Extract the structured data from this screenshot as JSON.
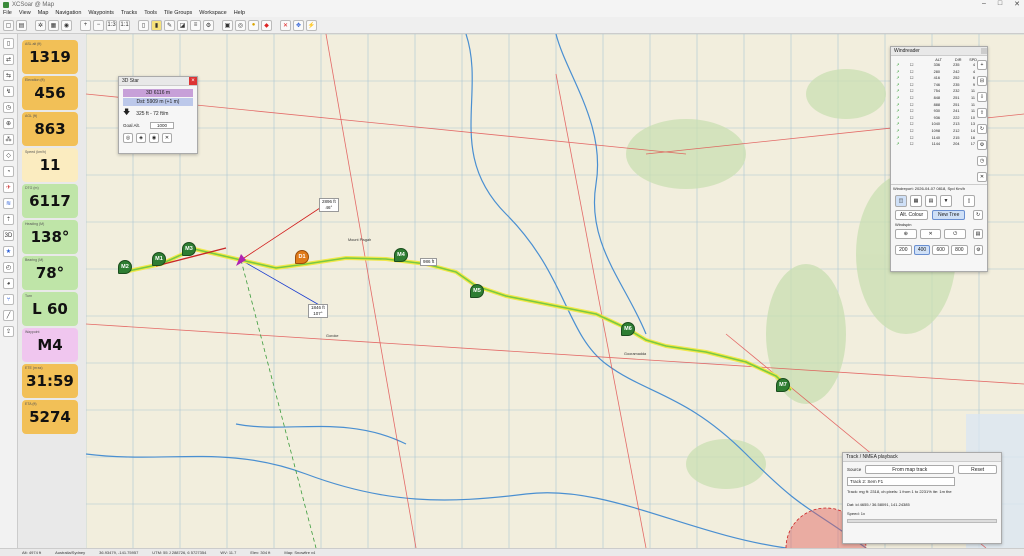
{
  "window": {
    "title": "XCSoar @ Map"
  },
  "menu": [
    "File",
    "View",
    "Map",
    "Navigation",
    "Waypoints",
    "Tracks",
    "Tools",
    "Tile Groups",
    "Workspace",
    "Help"
  ],
  "toolbar": {
    "icons": [
      "new-icon",
      "open-icon",
      "settings-icon",
      "map-icon",
      "eye-icon",
      "zoom-in-icon",
      "zoom-out-icon",
      "scale-icon",
      "scale-icon",
      "doc-icon",
      "book-icon",
      "edit-icon",
      "ruler-icon",
      "list-icon",
      "gear-icon",
      "lock-icon",
      "target-icon",
      "pin-icon",
      "flag-icon",
      "close-icon",
      "move-icon",
      "power-icon"
    ],
    "zoom_labels": [
      "1:3",
      "1:1"
    ]
  },
  "gauges": [
    {
      "label": "ASL alt (ft)",
      "value": "1319",
      "color": "#f2c057"
    },
    {
      "label": "Elevation (ft)",
      "value": "456",
      "color": "#f2c057"
    },
    {
      "label": "AGL (ft)",
      "value": "863",
      "color": "#f2c057"
    },
    {
      "label": "Speed (km/h)",
      "value": "11",
      "color": "#fbecc0"
    },
    {
      "label": "DTG (m)",
      "value": "6117",
      "color": "#bfe5a8"
    },
    {
      "label": "Heading (M)",
      "value": "138°",
      "color": "#bfe5a8"
    },
    {
      "label": "Bearing (M)",
      "value": "78°",
      "color": "#bfe5a8"
    },
    {
      "label": "Turn",
      "value": "L 60",
      "color": "#bfe5a8"
    },
    {
      "label": "Waypoint",
      "value": "M4",
      "color": "#f0c6ef"
    },
    {
      "label": "ETE (m:ss)",
      "value": "31:59",
      "color": "#f2c057"
    },
    {
      "label": "ETA (ft)",
      "value": "5274",
      "color": "#f2c057"
    }
  ],
  "star_panel": {
    "title": "3D Star",
    "row1": "3D 6116 m",
    "row2": "Dst: 5909 m (+1 m)",
    "row3": "325 ft - 72 ft/m",
    "goal_label": "Goal Alt.",
    "goal_value": "1000"
  },
  "map_labels": {
    "dist1": "2896 ft",
    "dist1b": "46°",
    "dist2": "1846 ft",
    "dist2b": "107°",
    "dist3": "986 ft"
  },
  "markers": [
    "M1",
    "M2",
    "M3",
    "D1",
    "M4",
    "M5",
    "M6",
    "M7"
  ],
  "place_labels": [
    "Mount Pisgah",
    "Goroke",
    "Gooramadda"
  ],
  "wind_panel": {
    "title": "Windreader",
    "headers": [
      "",
      "",
      "ALT",
      "DIR",
      "SPD"
    ],
    "rows": [
      [
        "↗",
        "☐",
        "336",
        "235",
        "4"
      ],
      [
        "↗",
        "☐",
        "280",
        "242",
        "4"
      ],
      [
        "↗",
        "☐",
        "416",
        "252",
        "6"
      ],
      [
        "↗",
        "☐",
        "746",
        "235",
        "9"
      ],
      [
        "↗",
        "☐",
        "754",
        "232",
        "11"
      ],
      [
        "↗",
        "☐",
        "848",
        "251",
        "11"
      ],
      [
        "↗",
        "☐",
        "888",
        "251",
        "11"
      ],
      [
        "↗",
        "☐",
        "930",
        "241",
        "11"
      ],
      [
        "↗",
        "☐",
        "936",
        "222",
        "10"
      ],
      [
        "↗",
        "☐",
        "1040",
        "213",
        "13"
      ],
      [
        "↗",
        "☐",
        "1098",
        "212",
        "14"
      ],
      [
        "↗",
        "☐",
        "1140",
        "215",
        "16"
      ],
      [
        "↗",
        "☐",
        "1144",
        "204",
        "17"
      ]
    ],
    "status": "Windreport: 2026-04-07 0818, Spd Km/h",
    "btn_all": "Alt. Colour",
    "btn_new": "New Tree",
    "windspin_label": "Windspin",
    "presets": [
      "200",
      "400",
      "600",
      "800"
    ]
  },
  "playback_panel": {
    "title": "Track / NMEA playback",
    "source_label": "Source",
    "source_btn": "From map track",
    "reset_btn": "Reset",
    "track_select": "Track 2: Sem F1",
    "info1": "Track: mg ft: 2318, ch:pixels: 1 from 1 to 2231% ite: 1m the",
    "info2": "Dat: id 4655 / 36.58091, 141.24385",
    "speed_label": "Speed: 1x"
  },
  "status": {
    "items": [
      "Alt: 4974 ft",
      "Australia/Sydney",
      "36.93479, -141.75957",
      "UTM: 55 J 288726, 6 5727354",
      "WV: 11.7",
      "Elev: 304 ft",
      "Map: Snowfire v4"
    ]
  },
  "colors": {
    "track_yellow": "#f1e84a",
    "track_green": "#7ac943",
    "route_red": "#d11a1a",
    "route_blue": "#1a3ccf",
    "marker_green": "#2e7d32",
    "marker_orange": "#e07b1a"
  }
}
